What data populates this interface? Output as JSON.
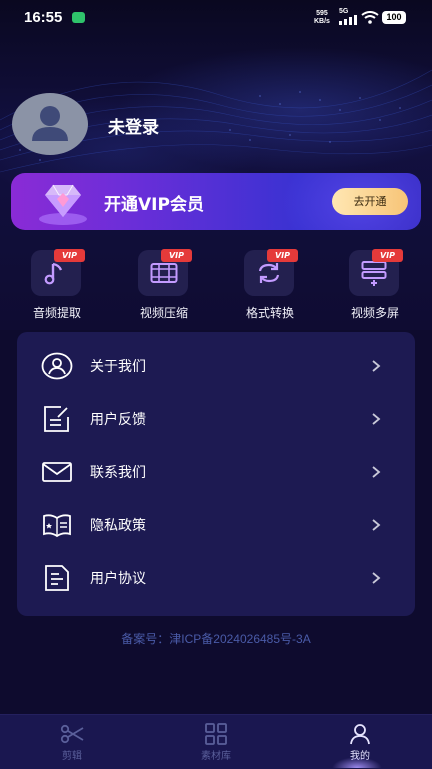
{
  "status_bar": {
    "time": "16:55",
    "speed_value": "595",
    "speed_unit": "KB/s",
    "network": "5G",
    "battery": "100"
  },
  "profile": {
    "name": "未登录"
  },
  "vip_banner": {
    "title": "开通VIP会员",
    "button": "去开通"
  },
  "tools": [
    {
      "label": "音频提取",
      "badge": "VIP",
      "icon": "music-note-icon"
    },
    {
      "label": "视频压缩",
      "badge": "VIP",
      "icon": "film-strip-icon"
    },
    {
      "label": "格式转换",
      "badge": "VIP",
      "icon": "convert-arrows-icon"
    },
    {
      "label": "视频多屏",
      "badge": "VIP",
      "icon": "multi-screen-icon"
    }
  ],
  "menu": [
    {
      "label": "关于我们",
      "icon": "user-circle-icon"
    },
    {
      "label": "用户反馈",
      "icon": "feedback-edit-icon"
    },
    {
      "label": "联系我们",
      "icon": "mail-icon"
    },
    {
      "label": "隐私政策",
      "icon": "privacy-book-icon"
    },
    {
      "label": "用户协议",
      "icon": "document-icon"
    }
  ],
  "icp": "备案号：津ICP备2024026485号-3A",
  "bottom_nav": [
    {
      "label": "剪辑",
      "icon": "scissors-icon",
      "active": false
    },
    {
      "label": "素材库",
      "icon": "grid-icon",
      "active": false
    },
    {
      "label": "我的",
      "icon": "person-icon",
      "active": true
    }
  ],
  "colors": {
    "background": "#0e0b2e",
    "card": "#1d1a52",
    "vip_badge": "#e53a3a",
    "vip_button": "#f7c477",
    "accent": "#8a5cf5"
  }
}
